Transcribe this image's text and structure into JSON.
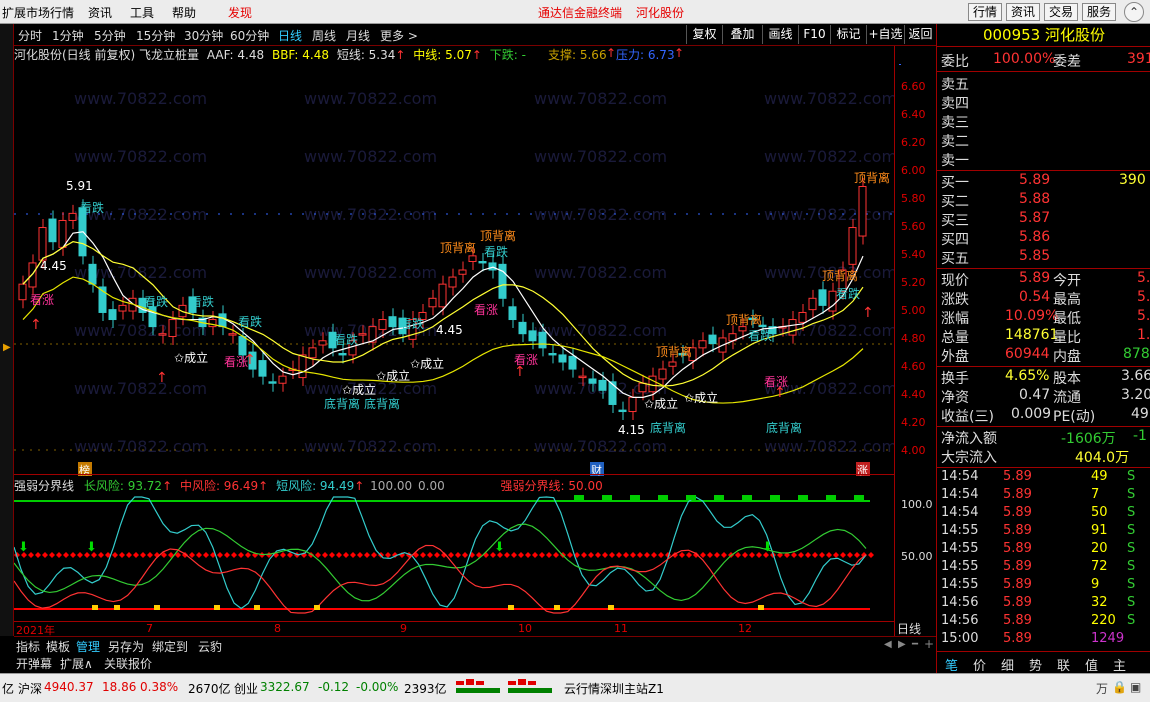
{
  "menu": {
    "items": [
      "扩展市场行情",
      "资讯",
      "工具",
      "帮助",
      "发现"
    ],
    "center": [
      "通达信金融终端",
      "河化股份"
    ],
    "right_buttons": [
      "行情",
      "资讯",
      "交易",
      "服务"
    ]
  },
  "periods": [
    "分时",
    "1分钟",
    "5分钟",
    "15分钟",
    "30分钟",
    "60分钟",
    "日线",
    "周线",
    "月线",
    "更多 >"
  ],
  "selected_period": "日线",
  "toolbar": [
    "复权",
    "叠加",
    "画线",
    "F10",
    "标记",
    "+自选",
    "返回"
  ],
  "chart_info": {
    "title": "河化股份(日线 前复权) 飞龙立桩量",
    "aaf": "AAF: 4.48",
    "bbf": "BBF: 4.48",
    "short": "短线: 5.34",
    "mid": "中线: 5.07",
    "down": "下跌: -",
    "support": "支撑: 5.66",
    "pressure": "压力: 6.73"
  },
  "y_axis": [
    "6.60",
    "6.40",
    "6.20",
    "6.00",
    "5.80",
    "5.60",
    "5.40",
    "5.20",
    "5.00",
    "4.80",
    "4.60",
    "4.40",
    "4.20",
    "4.00"
  ],
  "price_tags": {
    "high": "5.91",
    "low1": "4.45",
    "low2": "4.45",
    "low3": "4.15"
  },
  "annotations": {
    "top_div": "顶背离",
    "bot_div": "底背离",
    "up": "看涨",
    "down": "看跌",
    "set": "成立"
  },
  "markers": {
    "left": "榜",
    "mid": "财",
    "right": "涨"
  },
  "sub_info": {
    "title": "强弱分界线",
    "long": "长风险: 93.72",
    "mid": "中风险: 96.49",
    "short": "短风险: 94.49",
    "c100": "100.00",
    "c0": "0.00",
    "line": "强弱分界线: 50.00"
  },
  "sub_y": [
    "100.0",
    "50.00"
  ],
  "x_labels": [
    "2021年",
    "7",
    "8",
    "9",
    "10",
    "11",
    "12"
  ],
  "xaxis_right": "日线",
  "bottom_tabs": [
    "指标",
    "模板",
    "管理",
    "另存为",
    "绑定到",
    "云豹"
  ],
  "bottom2": [
    "开弹幕",
    "扩展∧",
    "关联报价"
  ],
  "status": {
    "lead": "亿",
    "sh_name": "沪深",
    "sh_val": "4940.37",
    "sh_chg": "18.86",
    "sh_pct": "0.38%",
    "sh_amt": "2670亿",
    "cy_name": "创业",
    "cy_val": "3322.67",
    "cy_chg": "-0.12",
    "cy_pct": "-0.00%",
    "cy_amt": "2393亿",
    "server": "云行情深圳主站Z1",
    "right_code": "万"
  },
  "quote": {
    "code": "000953",
    "name": "河化股份",
    "webi_label": "委比",
    "webi": "100.00%",
    "weicha_label": "委差",
    "weicha": "391",
    "sell": [
      [
        "卖五",
        ""
      ],
      [
        "卖四",
        ""
      ],
      [
        "卖三",
        ""
      ],
      [
        "卖二",
        ""
      ],
      [
        "卖一",
        ""
      ]
    ],
    "buy": [
      [
        "买一",
        "5.89",
        "390"
      ],
      [
        "买二",
        "5.88",
        ""
      ],
      [
        "买三",
        "5.87",
        ""
      ],
      [
        "买四",
        "5.86",
        ""
      ],
      [
        "买五",
        "5.85",
        ""
      ]
    ],
    "stats": [
      [
        "现价",
        "5.89",
        "今开",
        "5."
      ],
      [
        "涨跌",
        "0.54",
        "最高",
        "5."
      ],
      [
        "涨幅",
        "10.09%",
        "最低",
        "5."
      ],
      [
        "总量",
        "148761",
        "量比",
        "1."
      ],
      [
        "外盘",
        "60944",
        "内盘",
        "878"
      ]
    ],
    "stats2": [
      [
        "换手",
        "4.65%",
        "股本",
        "3.66"
      ],
      [
        "净资",
        "0.47",
        "流通",
        "3.20"
      ],
      [
        "收益(三)",
        "0.009",
        "PE(动)",
        "49"
      ]
    ],
    "netflow": [
      "净流入额",
      "-1606万",
      "-1"
    ],
    "bigflow": [
      "大宗流入",
      "404.0万"
    ]
  },
  "ticks": [
    [
      "14:54",
      "5.89",
      "49",
      "S"
    ],
    [
      "14:54",
      "5.89",
      "7",
      "S"
    ],
    [
      "14:54",
      "5.89",
      "50",
      "S"
    ],
    [
      "14:55",
      "5.89",
      "91",
      "S"
    ],
    [
      "14:55",
      "5.89",
      "20",
      "S"
    ],
    [
      "14:55",
      "5.89",
      "72",
      "S"
    ],
    [
      "14:55",
      "5.89",
      "9",
      "S"
    ],
    [
      "14:56",
      "5.89",
      "32",
      "S"
    ],
    [
      "14:56",
      "5.89",
      "220",
      "S"
    ],
    [
      "15:00",
      "5.89",
      "1249",
      ""
    ]
  ],
  "right_tabs": [
    "笔",
    "价",
    "细",
    "势",
    "联",
    "值",
    "主"
  ],
  "chart_data": {
    "type": "candlestick",
    "ylim": [
      4.0,
      6.6
    ],
    "y_ticks": [
      6.6,
      6.4,
      6.2,
      6.0,
      5.8,
      5.6,
      5.4,
      5.2,
      5.0,
      4.8,
      4.6,
      4.4,
      4.2,
      4.0
    ],
    "high_label": 5.91,
    "last": 5.89,
    "closes": [
      5.2,
      5.35,
      5.6,
      5.5,
      5.65,
      5.7,
      5.4,
      5.2,
      5.0,
      4.95,
      5.05,
      5.1,
      5.0,
      4.9,
      4.85,
      4.95,
      5.05,
      5.0,
      4.9,
      4.95,
      4.9,
      4.85,
      4.7,
      4.6,
      4.55,
      4.5,
      4.55,
      4.6,
      4.7,
      4.75,
      4.8,
      4.75,
      4.7,
      4.8,
      4.85,
      4.9,
      4.95,
      4.9,
      4.85,
      4.95,
      5.0,
      5.1,
      5.2,
      5.25,
      5.3,
      5.4,
      5.35,
      5.3,
      5.1,
      4.95,
      4.85,
      4.8,
      4.75,
      4.7,
      4.65,
      4.6,
      4.55,
      4.5,
      4.45,
      4.35,
      4.3,
      4.4,
      4.5,
      4.55,
      4.6,
      4.65,
      4.7,
      4.75,
      4.8,
      4.78,
      4.82,
      4.85,
      4.9,
      4.95,
      4.9,
      4.85,
      4.9,
      4.95,
      5.0,
      5.1,
      5.05,
      5.15,
      5.3,
      5.6,
      5.89
    ]
  }
}
